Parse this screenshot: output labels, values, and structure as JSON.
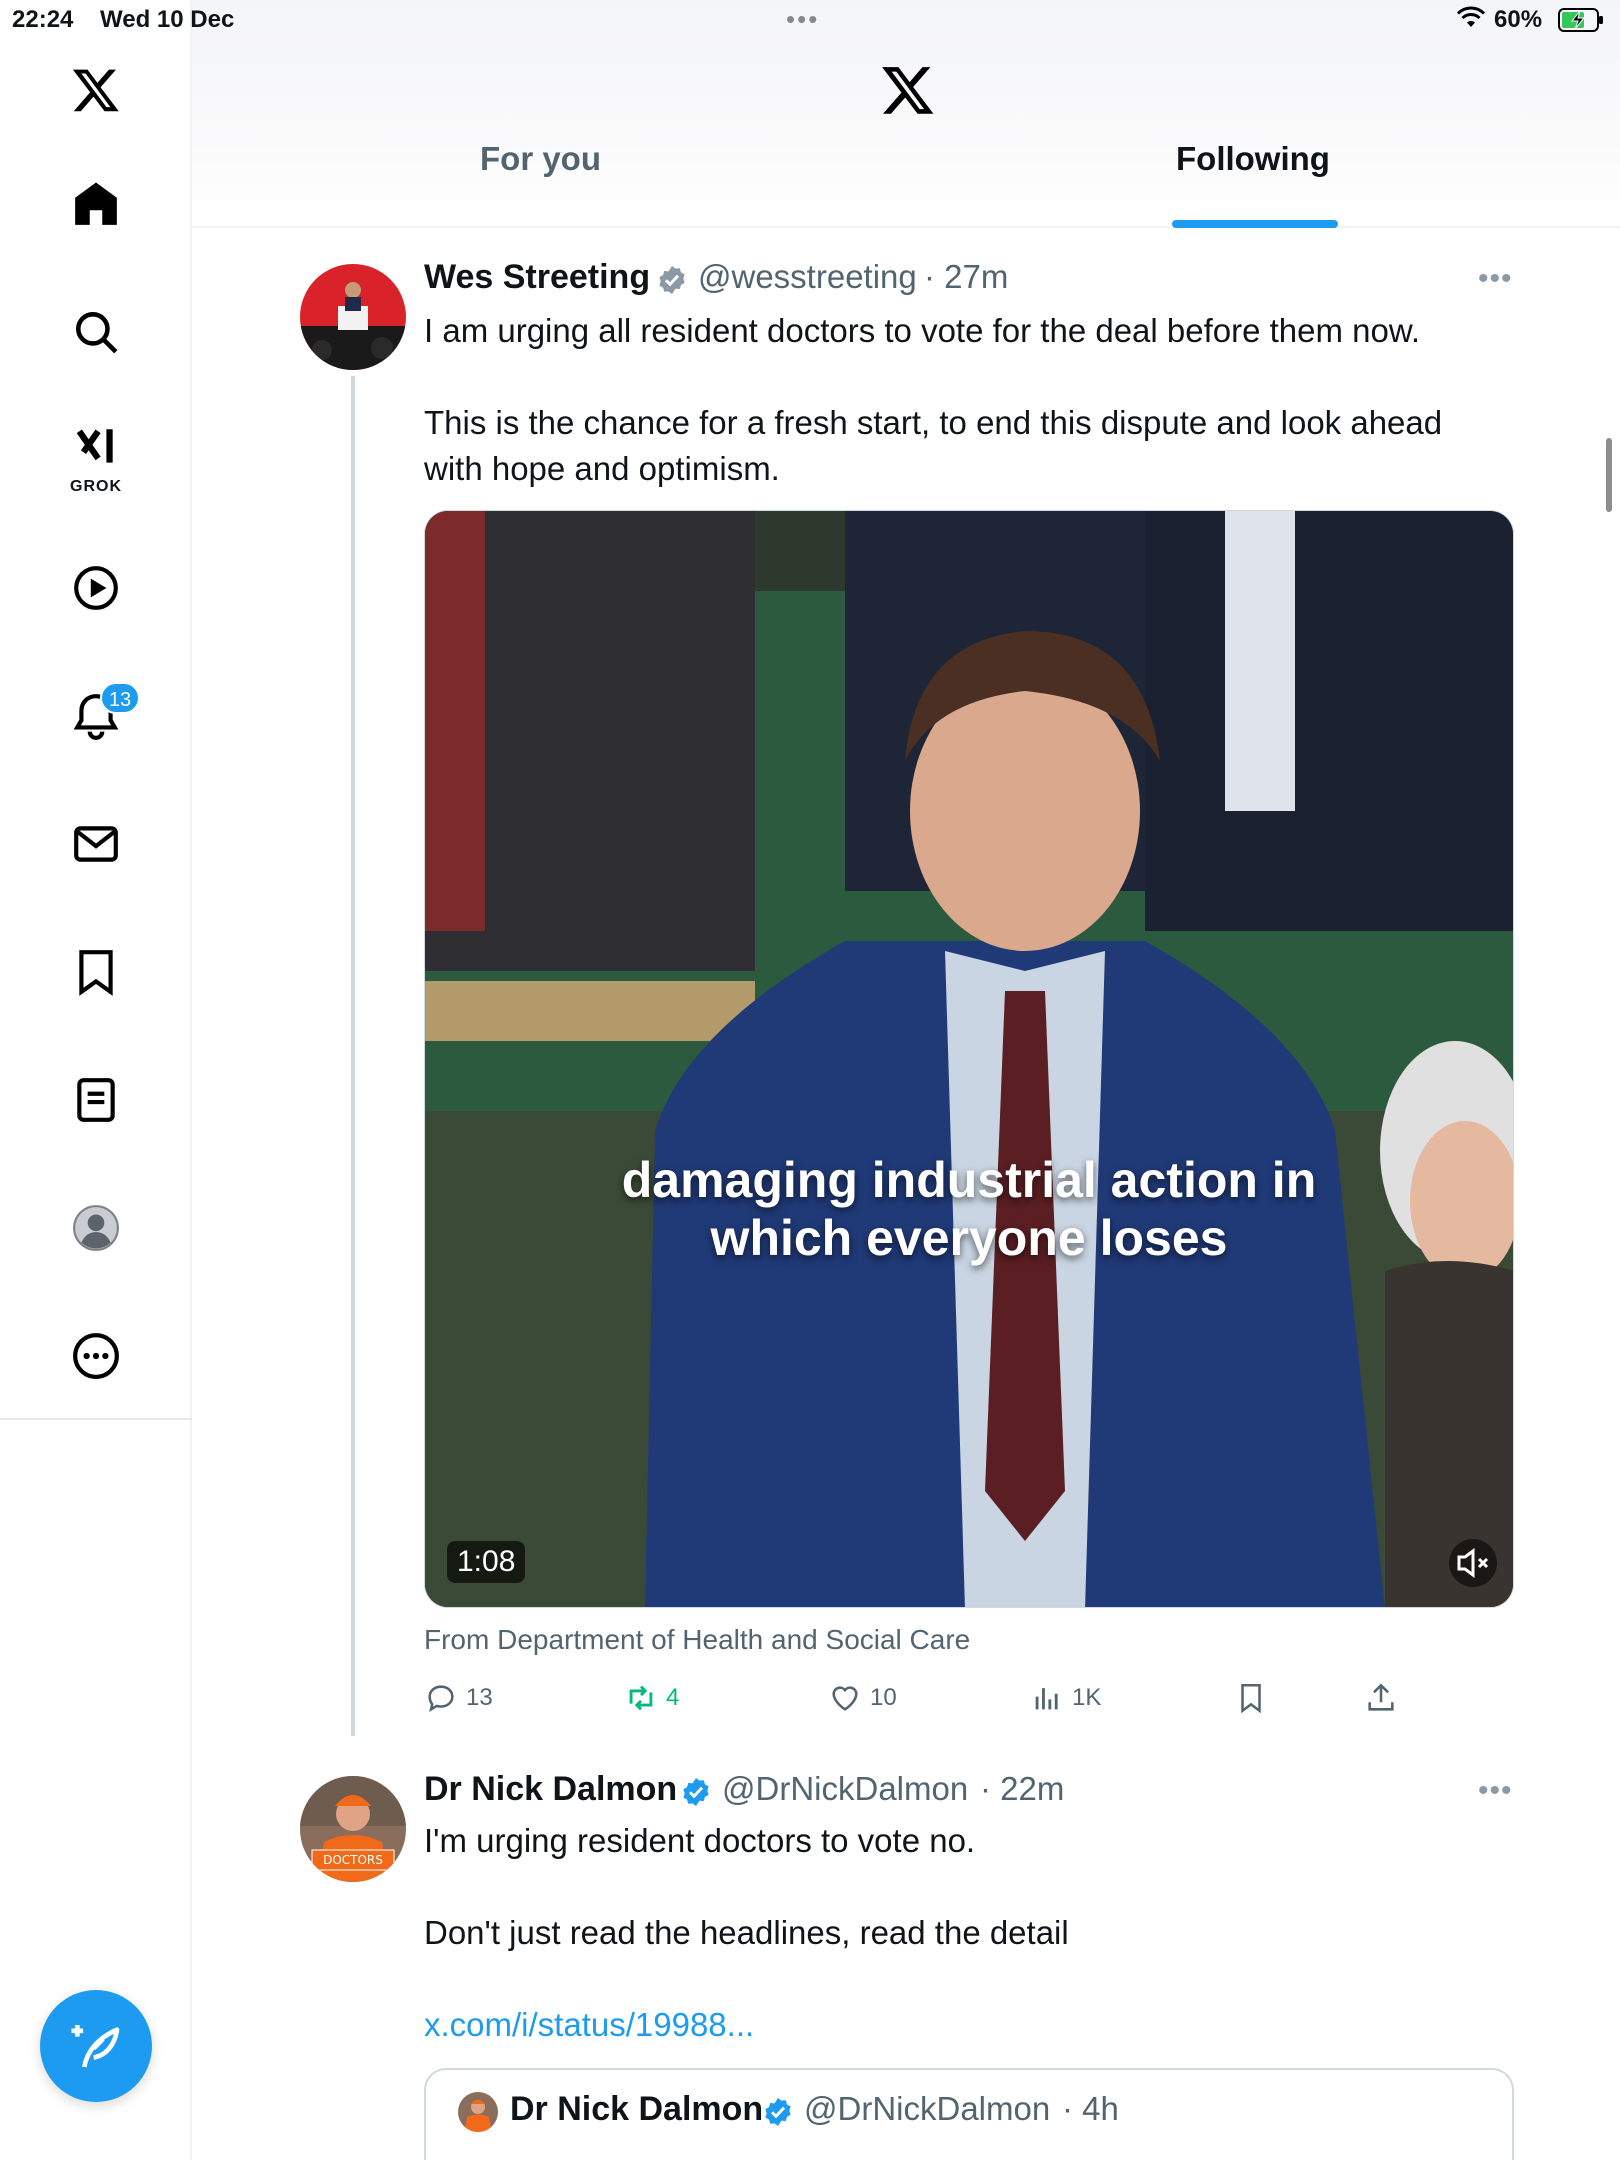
{
  "status_bar": {
    "time": "22:24",
    "date": "Wed 10 Dec",
    "battery": "60%"
  },
  "sidebar": {
    "grok_label": "GROK",
    "notifications_badge": "13"
  },
  "header": {
    "tabs": [
      {
        "label": "For you",
        "active": false
      },
      {
        "label": "Following",
        "active": true
      }
    ]
  },
  "tweets": [
    {
      "name": "Wes Streeting",
      "handle": "@wesstreeting",
      "time": "· 27m",
      "lines": [
        "I am urging all resident doctors to vote for the deal before them now.",
        "This is the chance for a fresh start, to end this dispute and look ahead",
        "with hope and optimism."
      ],
      "media": {
        "caption_line1": "damaging industrial action in",
        "caption_line2": "which everyone loses",
        "duration": "1:08"
      },
      "source": "From Department of Health and Social Care",
      "stats": {
        "replies": "13",
        "reposts": "4",
        "likes": "10",
        "views": "1K"
      }
    },
    {
      "name": "Dr Nick Dalmon",
      "handle": "@DrNickDalmon",
      "time": "· 22m",
      "lines": [
        "I'm urging resident doctors to vote no.",
        "Don't just read the headlines, read the detail"
      ],
      "link": "x.com/i/status/19988...",
      "avatar_text": "DOCTORS",
      "quote": {
        "name": "Dr Nick Dalmon",
        "handle": "@DrNickDalmon",
        "time": "· 4h"
      }
    }
  ],
  "colors": {
    "accent": "#1d9bf0",
    "repost_active": "#00ba7c",
    "secondary_text": "#536471"
  },
  "icons": [
    "x-logo-icon",
    "home-icon",
    "search-icon",
    "grok-icon",
    "video-icon",
    "bell-icon",
    "mail-icon",
    "bookmark-icon",
    "lists-icon",
    "profile-icon",
    "more-icon",
    "compose-icon"
  ]
}
